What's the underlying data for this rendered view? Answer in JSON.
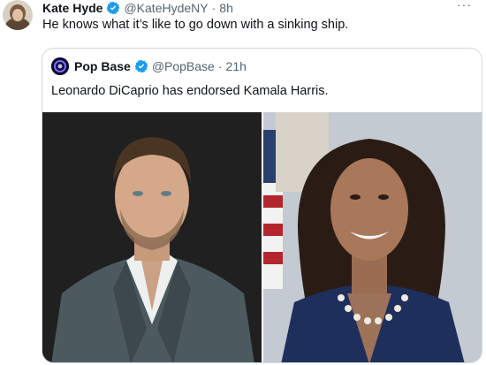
{
  "tweet": {
    "author_name": "Kate Hyde",
    "handle": "@KateHydeNY",
    "separator": "·",
    "time": "8h",
    "text": "He knows what it’s like to go down with a sinking ship.",
    "more_icon": "···"
  },
  "quote": {
    "author_name": "Pop Base",
    "handle": "@PopBase",
    "separator": "·",
    "time": "21h",
    "text": "Leonardo DiCaprio has endorsed Kamala Harris."
  },
  "colors": {
    "verified": "#1d9bf0",
    "secondary_text": "#536471",
    "border": "#cfd9de"
  }
}
